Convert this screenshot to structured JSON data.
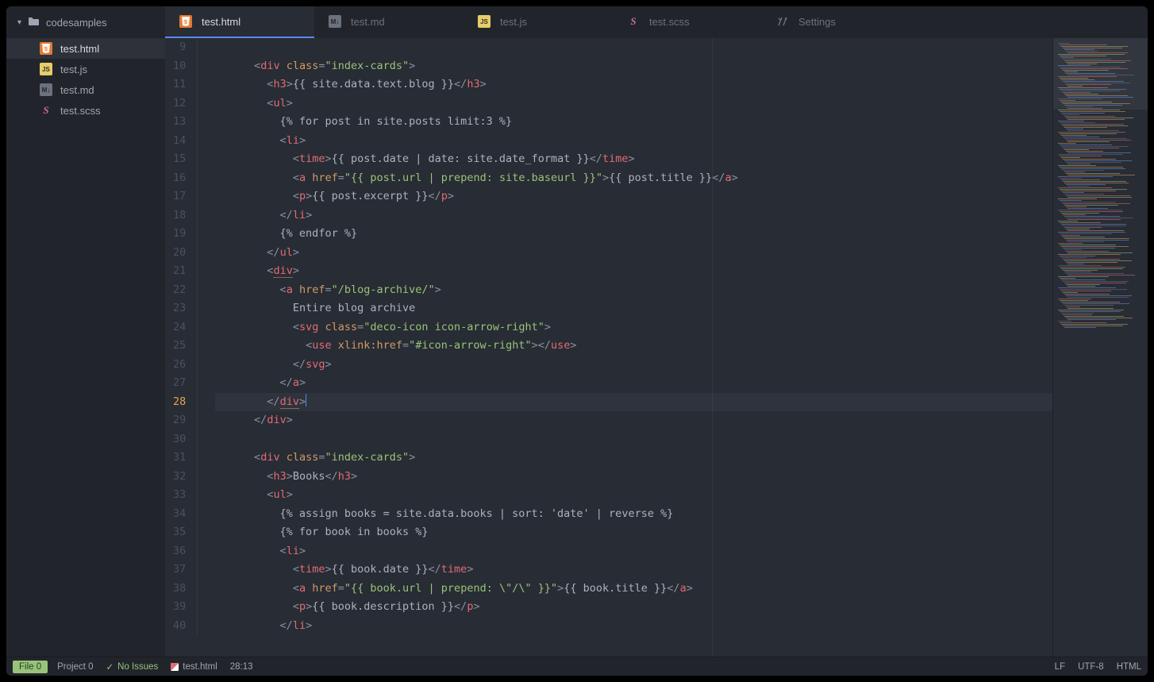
{
  "sidebar": {
    "folder": "codesamples",
    "files": [
      {
        "name": "test.html",
        "icon": "html"
      },
      {
        "name": "test.js",
        "icon": "js"
      },
      {
        "name": "test.md",
        "icon": "md"
      },
      {
        "name": "test.scss",
        "icon": "scss"
      }
    ]
  },
  "tabs": [
    {
      "label": "test.html",
      "icon": "html",
      "active": true
    },
    {
      "label": "test.md",
      "icon": "md",
      "active": false
    },
    {
      "label": "test.js",
      "icon": "js",
      "active": false
    },
    {
      "label": "test.scss",
      "icon": "scss",
      "active": false
    },
    {
      "label": "Settings",
      "icon": "settings",
      "active": false
    }
  ],
  "editor": {
    "first_line": 9,
    "current_line": 28,
    "lines": [
      {
        "n": 9,
        "tokens": []
      },
      {
        "n": 10,
        "indent": 3,
        "tokens": [
          [
            "g",
            "<"
          ],
          [
            "tag",
            "div"
          ],
          [
            "txt",
            " "
          ],
          [
            "attr",
            "class"
          ],
          [
            "g",
            "="
          ],
          [
            "str",
            "\"index-cards\""
          ],
          [
            "g",
            ">"
          ]
        ]
      },
      {
        "n": 11,
        "indent": 4,
        "tokens": [
          [
            "g",
            "<"
          ],
          [
            "tag",
            "h3"
          ],
          [
            "g",
            ">"
          ],
          [
            "txt",
            "{{ site.data.text.blog }}"
          ],
          [
            "g",
            "</"
          ],
          [
            "tag",
            "h3"
          ],
          [
            "g",
            ">"
          ]
        ]
      },
      {
        "n": 12,
        "indent": 4,
        "tokens": [
          [
            "g",
            "<"
          ],
          [
            "tag",
            "ul"
          ],
          [
            "g",
            ">"
          ]
        ]
      },
      {
        "n": 13,
        "indent": 5,
        "tokens": [
          [
            "txt",
            "{% for post in site.posts limit:3 %}"
          ]
        ]
      },
      {
        "n": 14,
        "indent": 5,
        "tokens": [
          [
            "g",
            "<"
          ],
          [
            "tag",
            "li"
          ],
          [
            "g",
            ">"
          ]
        ]
      },
      {
        "n": 15,
        "indent": 6,
        "tokens": [
          [
            "g",
            "<"
          ],
          [
            "tag",
            "time"
          ],
          [
            "g",
            ">"
          ],
          [
            "txt",
            "{{ post.date | date: site.date_format }}"
          ],
          [
            "g",
            "</"
          ],
          [
            "tag",
            "time"
          ],
          [
            "g",
            ">"
          ]
        ]
      },
      {
        "n": 16,
        "indent": 6,
        "tokens": [
          [
            "g",
            "<"
          ],
          [
            "tag",
            "a"
          ],
          [
            "txt",
            " "
          ],
          [
            "attr",
            "href"
          ],
          [
            "g",
            "="
          ],
          [
            "str",
            "\"{{ post.url | prepend: site.baseurl }}\""
          ],
          [
            "g",
            ">"
          ],
          [
            "txt",
            "{{ post.title }}"
          ],
          [
            "g",
            "</"
          ],
          [
            "tag",
            "a"
          ],
          [
            "g",
            ">"
          ]
        ]
      },
      {
        "n": 17,
        "indent": 6,
        "tokens": [
          [
            "g",
            "<"
          ],
          [
            "tag",
            "p"
          ],
          [
            "g",
            ">"
          ],
          [
            "txt",
            "{{ post.excerpt }}"
          ],
          [
            "g",
            "</"
          ],
          [
            "tag",
            "p"
          ],
          [
            "g",
            ">"
          ]
        ]
      },
      {
        "n": 18,
        "indent": 5,
        "tokens": [
          [
            "g",
            "</"
          ],
          [
            "tag",
            "li"
          ],
          [
            "g",
            ">"
          ]
        ]
      },
      {
        "n": 19,
        "indent": 5,
        "tokens": [
          [
            "txt",
            "{% endfor %}"
          ]
        ]
      },
      {
        "n": 20,
        "indent": 4,
        "tokens": [
          [
            "g",
            "</"
          ],
          [
            "tag",
            "ul"
          ],
          [
            "g",
            ">"
          ]
        ]
      },
      {
        "n": 21,
        "indent": 4,
        "tokens": [
          [
            "g",
            "<"
          ],
          [
            "tag u",
            "div"
          ],
          [
            "g",
            ">"
          ]
        ]
      },
      {
        "n": 22,
        "indent": 5,
        "tokens": [
          [
            "g",
            "<"
          ],
          [
            "tag",
            "a"
          ],
          [
            "txt",
            " "
          ],
          [
            "attr",
            "href"
          ],
          [
            "g",
            "="
          ],
          [
            "str",
            "\"/blog-archive/\""
          ],
          [
            "g",
            ">"
          ]
        ]
      },
      {
        "n": 23,
        "indent": 6,
        "tokens": [
          [
            "txt",
            "Entire blog archive"
          ]
        ]
      },
      {
        "n": 24,
        "indent": 6,
        "tokens": [
          [
            "g",
            "<"
          ],
          [
            "tag",
            "svg"
          ],
          [
            "txt",
            " "
          ],
          [
            "attr",
            "class"
          ],
          [
            "g",
            "="
          ],
          [
            "str",
            "\"deco-icon icon-arrow-right\""
          ],
          [
            "g",
            ">"
          ]
        ]
      },
      {
        "n": 25,
        "indent": 7,
        "tokens": [
          [
            "g",
            "<"
          ],
          [
            "tag",
            "use"
          ],
          [
            "txt",
            " "
          ],
          [
            "attr",
            "xlink:href"
          ],
          [
            "g",
            "="
          ],
          [
            "str",
            "\"#icon-arrow-right\""
          ],
          [
            "g",
            ">"
          ],
          [
            "g",
            "</"
          ],
          [
            "tag",
            "use"
          ],
          [
            "g",
            ">"
          ]
        ]
      },
      {
        "n": 26,
        "indent": 6,
        "tokens": [
          [
            "g",
            "</"
          ],
          [
            "tag",
            "svg"
          ],
          [
            "g",
            ">"
          ]
        ]
      },
      {
        "n": 27,
        "indent": 5,
        "tokens": [
          [
            "g",
            "</"
          ],
          [
            "tag",
            "a"
          ],
          [
            "g",
            ">"
          ]
        ]
      },
      {
        "n": 28,
        "indent": 4,
        "hl": true,
        "tokens": [
          [
            "g",
            "</"
          ],
          [
            "tag u",
            "div"
          ],
          [
            "g",
            ">"
          ],
          [
            "cursor",
            ""
          ]
        ]
      },
      {
        "n": 29,
        "indent": 3,
        "tokens": [
          [
            "g",
            "</"
          ],
          [
            "tag",
            "div"
          ],
          [
            "g",
            ">"
          ]
        ]
      },
      {
        "n": 30,
        "tokens": []
      },
      {
        "n": 31,
        "indent": 3,
        "tokens": [
          [
            "g",
            "<"
          ],
          [
            "tag",
            "div"
          ],
          [
            "txt",
            " "
          ],
          [
            "attr",
            "class"
          ],
          [
            "g",
            "="
          ],
          [
            "str",
            "\"index-cards\""
          ],
          [
            "g",
            ">"
          ]
        ]
      },
      {
        "n": 32,
        "indent": 4,
        "tokens": [
          [
            "g",
            "<"
          ],
          [
            "tag",
            "h3"
          ],
          [
            "g",
            ">"
          ],
          [
            "txt",
            "Books"
          ],
          [
            "g",
            "</"
          ],
          [
            "tag",
            "h3"
          ],
          [
            "g",
            ">"
          ]
        ]
      },
      {
        "n": 33,
        "indent": 4,
        "tokens": [
          [
            "g",
            "<"
          ],
          [
            "tag",
            "ul"
          ],
          [
            "g",
            ">"
          ]
        ]
      },
      {
        "n": 34,
        "indent": 5,
        "tokens": [
          [
            "txt",
            "{% assign books = site.data.books | sort: 'date' | reverse %}"
          ]
        ]
      },
      {
        "n": 35,
        "indent": 5,
        "tokens": [
          [
            "txt",
            "{% for book in books %}"
          ]
        ]
      },
      {
        "n": 36,
        "indent": 5,
        "tokens": [
          [
            "g",
            "<"
          ],
          [
            "tag",
            "li"
          ],
          [
            "g",
            ">"
          ]
        ]
      },
      {
        "n": 37,
        "indent": 6,
        "tokens": [
          [
            "g",
            "<"
          ],
          [
            "tag",
            "time"
          ],
          [
            "g",
            ">"
          ],
          [
            "txt",
            "{{ book.date }}"
          ],
          [
            "g",
            "</"
          ],
          [
            "tag",
            "time"
          ],
          [
            "g",
            ">"
          ]
        ]
      },
      {
        "n": 38,
        "indent": 6,
        "tokens": [
          [
            "g",
            "<"
          ],
          [
            "tag",
            "a"
          ],
          [
            "txt",
            " "
          ],
          [
            "attr",
            "href"
          ],
          [
            "g",
            "="
          ],
          [
            "str",
            "\"{{ book.url | prepend: \\\"/\\\" }}\""
          ],
          [
            "g",
            ">"
          ],
          [
            "txt",
            "{{ book.title }}"
          ],
          [
            "g",
            "</"
          ],
          [
            "tag",
            "a"
          ],
          [
            "g",
            ">"
          ]
        ]
      },
      {
        "n": 39,
        "indent": 6,
        "tokens": [
          [
            "g",
            "<"
          ],
          [
            "tag",
            "p"
          ],
          [
            "g",
            ">"
          ],
          [
            "txt",
            "{{ book.description }}"
          ],
          [
            "g",
            "</"
          ],
          [
            "tag",
            "p"
          ],
          [
            "g",
            ">"
          ]
        ]
      },
      {
        "n": 40,
        "indent": 5,
        "tokens": [
          [
            "g",
            "</"
          ],
          [
            "tag",
            "li"
          ],
          [
            "g",
            ">"
          ]
        ]
      }
    ]
  },
  "statusbar": {
    "file_badge": "File 0",
    "project": "Project 0",
    "issues": "No Issues",
    "filename": "test.html",
    "cursor": "28:13",
    "eol": "LF",
    "encoding": "UTF-8",
    "lang": "HTML"
  },
  "icons": {
    "html": "5",
    "md": "M↓",
    "js": "JS",
    "scss": "Sc",
    "settings": "✕"
  }
}
